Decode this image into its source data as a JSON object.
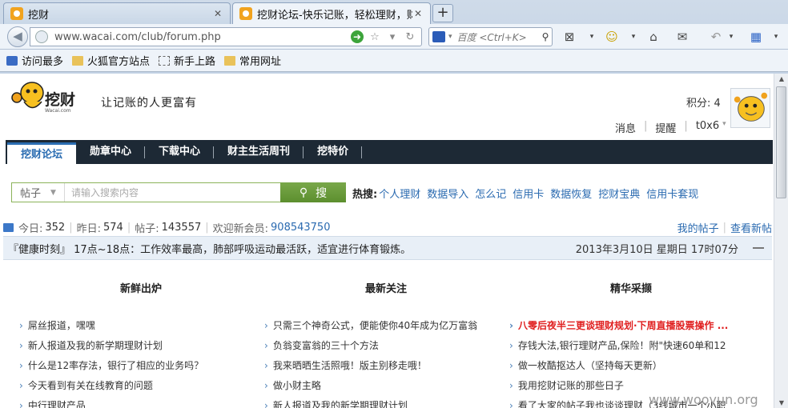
{
  "browser": {
    "tabs": [
      {
        "label": "挖财",
        "active": false
      },
      {
        "label": "挖财论坛-快乐记账，轻松理财，财主...",
        "active": true
      }
    ],
    "new_tab": "+",
    "url": "www.wacai.com/club/forum.php",
    "search_placeholder": "百度 <Ctrl+K>",
    "bookmarks": [
      "访问最多",
      "火狐官方站点",
      "新手上路",
      "常用网址"
    ]
  },
  "header": {
    "slogan": "让记账的人更富有",
    "score_label": "积分: 4",
    "user_links": [
      "消息",
      "提醒",
      "t0x6"
    ]
  },
  "forum_nav": [
    "挖财论坛",
    "勋章中心",
    "下载中心",
    "财主生活周刊",
    "挖特价"
  ],
  "search": {
    "type": "帖子",
    "placeholder": "请输入搜索内容",
    "button": "搜",
    "hot_label": "热搜:",
    "hot_terms": [
      "个人理财",
      "数据导入",
      "怎么记",
      "信用卡",
      "数据恢复",
      "挖财宝典",
      "信用卡套现"
    ]
  },
  "stats": {
    "today_label": "今日:",
    "today": "352",
    "yesterday_label": "昨日:",
    "yesterday": "574",
    "posts_label": "帖子:",
    "posts": "143557",
    "welcome_label": "欢迎新会员:",
    "new_member": "908543750",
    "my_posts": "我的帖子",
    "view_new": "查看新帖"
  },
  "notice": {
    "text": "『健康时刻』 17点~18点：工作效率最高，肺部呼吸运动最活跃，适宜进行体育锻炼。",
    "date": "2013年3月10日  星期日  17时07分"
  },
  "columns": [
    {
      "title": "新鲜出炉",
      "items": [
        "屌丝报道，嘿嘿",
        "新人报道及我的新学期理财计划",
        "什么是12率存法，银行了相应的业务吗？",
        "今天看到有关在线教育的问题",
        "中行理财产品"
      ]
    },
    {
      "title": "最新关注",
      "items": [
        "只需三个神奇公式，便能使你40年成为亿万富翁",
        "负翁变富翁的三十个方法",
        "我来晒晒生活照哦！版主别移走哦！",
        "做小财主略",
        "新人报道及我的新学期理财计划"
      ]
    },
    {
      "title": "精华采撷",
      "items": [
        "八零后夜半三更谈理财规划·下周直播股票操作 ...",
        "存钱大法,银行理财产品,保险！附\"快速60单和12",
        "做一枚酷抠达人（坚持每天更新）",
        "我用挖财记账的那些日子",
        "看了大家的帖子我也谈谈理财（3线城市一个小职"
      ]
    }
  ],
  "watermark": "www.wooyun.org",
  "colors": {
    "nav_bg": "#1d2935",
    "link_blue": "#2a6ab0",
    "search_green": "#6a9d3b",
    "hot_red": "#e02020"
  }
}
